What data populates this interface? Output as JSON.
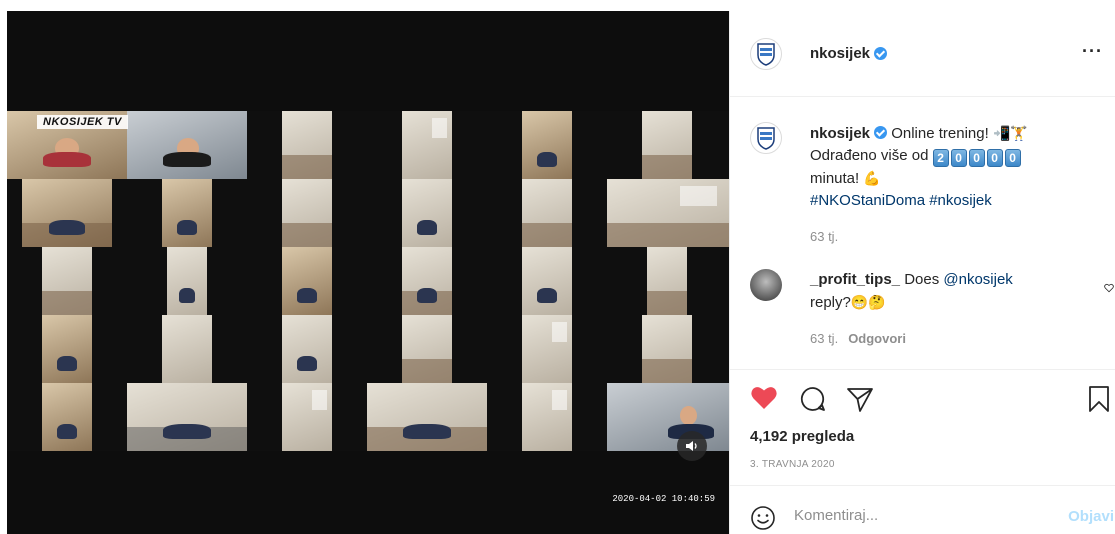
{
  "video": {
    "overlay_logo": "NKOSIJEK TV",
    "timestamp": "2020-04-02 10:40:59",
    "sound_icon": "speaker-icon"
  },
  "header": {
    "username": "nkosijek",
    "verified": true,
    "more_icon": "more-horizontal-icon"
  },
  "caption": {
    "username": "nkosijek",
    "text_1": "Online trening!",
    "text_2": "Odrađeno više od",
    "counter": [
      "2",
      "0",
      "0",
      "0",
      "0"
    ],
    "text_3": "minuta!",
    "hashtags": "#NKOStaniDoma #nkosijek",
    "time": "63 tj."
  },
  "comments": [
    {
      "username": "_profit_tips_",
      "text_1": "Does",
      "mention": "@nkosijek",
      "text_2": "reply?",
      "time": "63 tj.",
      "reply_label": "Odgovori"
    }
  ],
  "stats": {
    "views": "4,192 pregleda",
    "date": "3. TRAVNJA 2020"
  },
  "comment_input": {
    "placeholder": "Komentiraj...",
    "post_label": "Objavi"
  },
  "colors": {
    "like_active": "#ed4956",
    "verified": "#3897f0",
    "hashtag": "#00376b",
    "post_disabled": "#b2dffc"
  }
}
